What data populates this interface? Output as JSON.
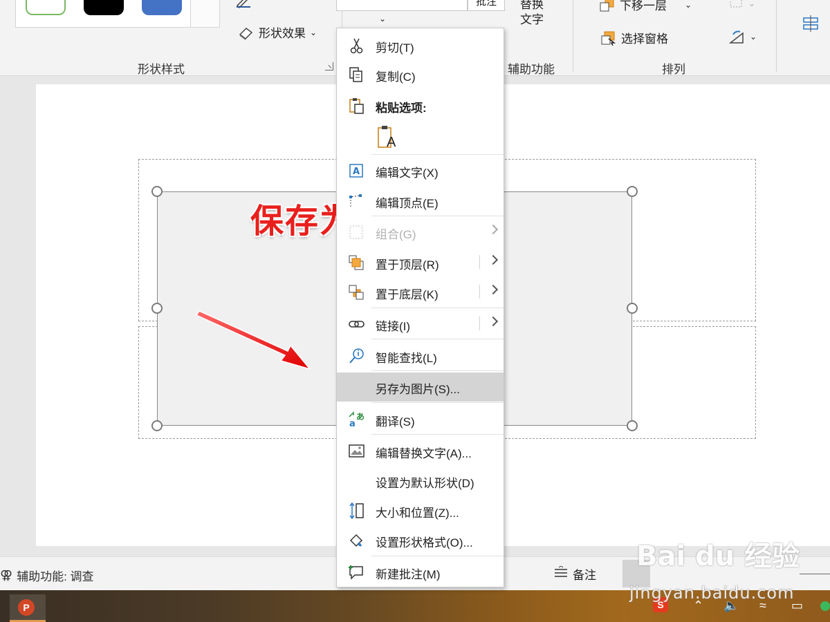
{
  "ribbon": {
    "shape_effect_label": "形状效果",
    "group_shape_styles": "形状样式",
    "group_accessibility": "辅助功能",
    "group_arrange": "排列",
    "alt_text_line1": "替换",
    "alt_text_line2": "文字",
    "send_backward": "下移一层",
    "selection_pane": "选择窗格",
    "comment_stub": "批注"
  },
  "slide": {
    "overlay_label": "保存为图片"
  },
  "context_menu": {
    "items": [
      {
        "label": "剪切(T)",
        "icon": "scissors-icon"
      },
      {
        "label": "复制(C)",
        "icon": "copy-icon"
      },
      {
        "label": "粘贴选项:",
        "icon": "paste-icon"
      },
      {
        "label": "A",
        "icon": "paste-keep-text-icon"
      },
      {
        "label": "编辑文字(X)",
        "icon": "edit-text-icon"
      },
      {
        "label": "编辑顶点(E)",
        "icon": "edit-points-icon"
      },
      {
        "label": "组合(G)",
        "icon": "group-icon"
      },
      {
        "label": "置于顶层(R)",
        "icon": "bring-to-front-icon"
      },
      {
        "label": "置于底层(K)",
        "icon": "send-to-back-icon"
      },
      {
        "label": "链接(I)",
        "icon": "link-icon"
      },
      {
        "label": "智能查找(L)",
        "icon": "smart-lookup-icon"
      },
      {
        "label": "另存为图片(S)...",
        "icon": ""
      },
      {
        "label": "翻译(S)",
        "icon": "translate-icon"
      },
      {
        "label": "编辑替换文字(A)...",
        "icon": "alt-text-icon"
      },
      {
        "label": "设置为默认形状(D)",
        "icon": ""
      },
      {
        "label": "大小和位置(Z)...",
        "icon": "size-position-icon"
      },
      {
        "label": "设置形状格式(O)...",
        "icon": "format-shape-icon"
      },
      {
        "label": "新建批注(M)",
        "icon": "new-comment-icon"
      }
    ]
  },
  "statusbar": {
    "accessibility": "辅助功能: 调查",
    "notes": "备注"
  },
  "watermark": {
    "logo": "Bai du 经验",
    "url": "jingyan.baidu.com"
  },
  "colors": {
    "accent_red": "#e8201d",
    "menu_highlight": "#d4d4d4",
    "swatch_green": "#7cb862",
    "swatch_blue": "#4472c4"
  }
}
